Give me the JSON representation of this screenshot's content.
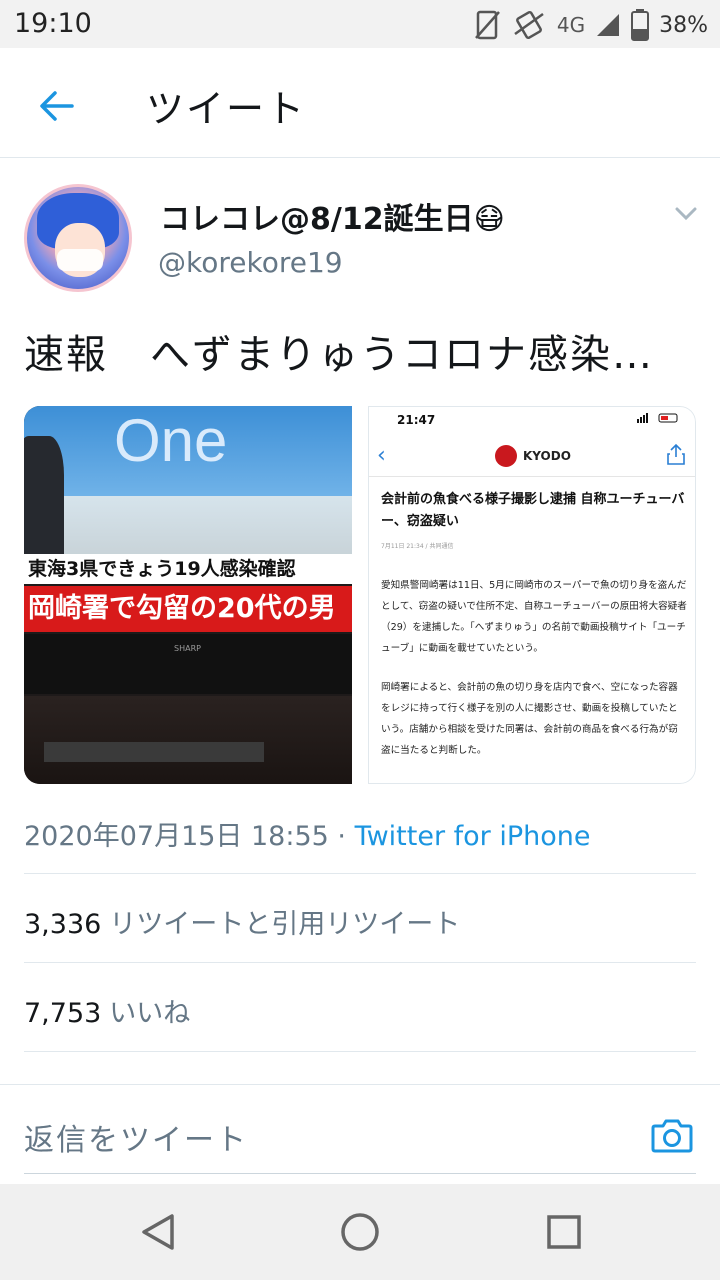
{
  "status_bar": {
    "time": "19:10",
    "network": "4G",
    "battery": "38%"
  },
  "header": {
    "title": "ツイート"
  },
  "tweet": {
    "author_name": "コレコレ@8/12誕生日😷",
    "author_handle": "@korekore19",
    "text": "速報　へずまりゅうコロナ感染…",
    "media": {
      "left": {
        "tv_logo": "One",
        "caption_top": "東海3県できょう19人感染確認",
        "caption_main": "岡崎署で勾留の20代の男",
        "tv_brand": "SHARP"
      },
      "right": {
        "phone_time": "21:47",
        "app_logo": "KYODO",
        "headline": "会計前の魚食べる様子撮影し逮捕 自称ユーチューバー、窃盗疑い",
        "date": "7月11日 21:34 / 共同通信",
        "paragraph1": "愛知県警岡崎署は11日、5月に岡崎市のスーパーで魚の切り身を盗んだとして、窃盗の疑いで住所不定、自称ユーチューバーの原田将大容疑者（29）を逮捕した。「へずまりゅう」の名前で動画投稿サイト「ユーチューブ」に動画を載せていたという。",
        "paragraph2": "岡崎署によると、会計前の魚の切り身を店内で食べ、空になった容器をレジに持って行く様子を別の人に撮影させ、動画を投稿していたという。店舗から相談を受けた同署は、会計前の商品を食べる行為が窃盗に当たると判断した。"
      }
    },
    "timestamp": "2020年07月15日 18:55 · ",
    "source": "Twitter for iPhone",
    "retweets_count": "3,336",
    "retweets_label": "リツイートと引用リツイート",
    "likes_count": "7,753",
    "likes_label": "いいね"
  },
  "reply": {
    "placeholder": "返信をツイート"
  },
  "colors": {
    "accent": "#1b95e0",
    "muted": "#657786",
    "text": "#14171a"
  },
  "icons": [
    "arrow-left-icon",
    "chevron-down-icon",
    "camera-icon",
    "nav-back-icon",
    "nav-home-icon",
    "nav-recents-icon"
  ]
}
